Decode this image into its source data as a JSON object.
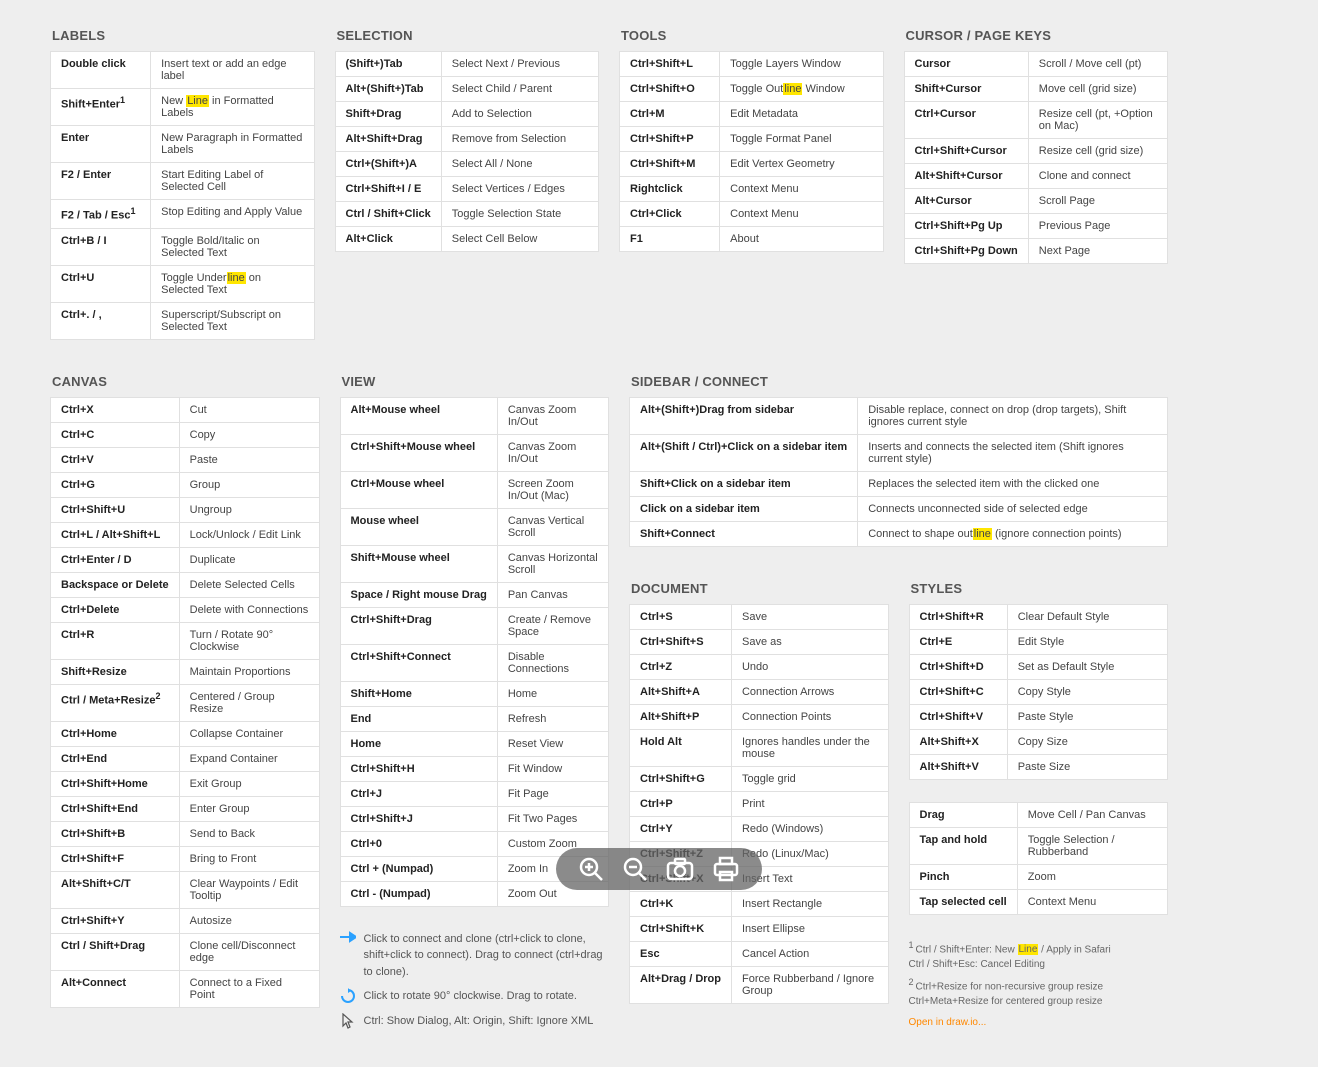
{
  "sections": {
    "labels": {
      "title": "LABELS",
      "rows": [
        {
          "k": "Double click",
          "d": "Insert text or add an edge label"
        },
        {
          "k": "Shift+Enter",
          "k_sup": "1",
          "d": "New [[Line]] in Formatted Labels"
        },
        {
          "k": "Enter",
          "d": "New Paragraph in Formatted Labels"
        },
        {
          "k": "F2 / Enter",
          "d": "Start Editing Label of Selected Cell"
        },
        {
          "k": "F2 / Tab / Esc",
          "k_sup": "1",
          "d": "Stop Editing and Apply Value"
        },
        {
          "k": "Ctrl+B / I",
          "d": "Toggle Bold/Italic on Selected Text"
        },
        {
          "k": "Ctrl+U",
          "d": "Toggle Under[[line]] on Selected Text"
        },
        {
          "k": "Ctrl+. / ,",
          "d": "Superscript/Subscript on Selected Text"
        }
      ]
    },
    "selection": {
      "title": "SELECTION",
      "rows": [
        {
          "k": "(Shift+)Tab",
          "d": "Select Next / Previous"
        },
        {
          "k": "Alt+(Shift+)Tab",
          "d": "Select Child / Parent"
        },
        {
          "k": "Shift+Drag",
          "d": "Add to Selection"
        },
        {
          "k": "Alt+Shift+Drag",
          "d": "Remove from Selection"
        },
        {
          "k": "Ctrl+(Shift+)A",
          "d": "Select All / None"
        },
        {
          "k": "Ctrl+Shift+I / E",
          "d": "Select Vertices / Edges"
        },
        {
          "k": "Ctrl / Shift+Click",
          "d": "Toggle Selection State"
        },
        {
          "k": "Alt+Click",
          "d": "Select Cell Below"
        }
      ]
    },
    "tools": {
      "title": "TOOLS",
      "rows": [
        {
          "k": "Ctrl+Shift+L",
          "d": "Toggle Layers Window"
        },
        {
          "k": "Ctrl+Shift+O",
          "d": "Toggle Out[[line]] Window"
        },
        {
          "k": "Ctrl+M",
          "d": "Edit Metadata"
        },
        {
          "k": "Ctrl+Shift+P",
          "d": "Toggle Format Panel"
        },
        {
          "k": "Ctrl+Shift+M",
          "d": "Edit Vertex Geometry"
        },
        {
          "k": "Rightclick",
          "d": "Context Menu"
        },
        {
          "k": "Ctrl+Click",
          "d": "Context Menu"
        },
        {
          "k": "F1",
          "d": "About"
        }
      ]
    },
    "cursor": {
      "title": "CURSOR / PAGE KEYS",
      "rows": [
        {
          "k": "Cursor",
          "d": "Scroll / Move cell (pt)"
        },
        {
          "k": "Shift+Cursor",
          "d": "Move cell (grid size)"
        },
        {
          "k": "Ctrl+Cursor",
          "d": "Resize cell (pt, +Option on Mac)"
        },
        {
          "k": "Ctrl+Shift+Cursor",
          "d": "Resize cell (grid size)"
        },
        {
          "k": "Alt+Shift+Cursor",
          "d": "Clone and connect"
        },
        {
          "k": "Alt+Cursor",
          "d": "Scroll Page"
        },
        {
          "k": "Ctrl+Shift+Pg Up",
          "d": "Previous Page"
        },
        {
          "k": "Ctrl+Shift+Pg Down",
          "d": "Next Page"
        }
      ]
    },
    "canvas": {
      "title": "CANVAS",
      "rows": [
        {
          "k": "Ctrl+X",
          "d": "Cut"
        },
        {
          "k": "Ctrl+C",
          "d": "Copy"
        },
        {
          "k": "Ctrl+V",
          "d": "Paste"
        },
        {
          "k": "Ctrl+G",
          "d": "Group"
        },
        {
          "k": "Ctrl+Shift+U",
          "d": "Ungroup"
        },
        {
          "k": "Ctrl+L / Alt+Shift+L",
          "d": "Lock/Unlock / Edit Link"
        },
        {
          "k": "Ctrl+Enter / D",
          "d": "Duplicate"
        },
        {
          "k": "Backspace or Delete",
          "d": "Delete Selected Cells"
        },
        {
          "k": "Ctrl+Delete",
          "d": "Delete with Connections"
        },
        {
          "k": "Ctrl+R",
          "d": "Turn / Rotate 90° Clockwise"
        },
        {
          "k": "Shift+Resize",
          "d": "Maintain Proportions"
        },
        {
          "k": "Ctrl / Meta+Resize",
          "k_sup": "2",
          "d": "Centered / Group Resize"
        },
        {
          "k": "Ctrl+Home",
          "d": "Collapse Container"
        },
        {
          "k": "Ctrl+End",
          "d": "Expand Container"
        },
        {
          "k": "Ctrl+Shift+Home",
          "d": "Exit Group"
        },
        {
          "k": "Ctrl+Shift+End",
          "d": "Enter Group"
        },
        {
          "k": "Ctrl+Shift+B",
          "d": "Send to Back"
        },
        {
          "k": "Ctrl+Shift+F",
          "d": "Bring to Front"
        },
        {
          "k": "Alt+Shift+C/T",
          "d": "Clear Waypoints / Edit Tooltip"
        },
        {
          "k": "Ctrl+Shift+Y",
          "d": "Autosize"
        },
        {
          "k": "Ctrl / Shift+Drag",
          "d": "Clone cell/Disconnect edge"
        },
        {
          "k": "Alt+Connect",
          "d": "Connect to a Fixed Point"
        }
      ]
    },
    "view": {
      "title": "VIEW",
      "rows": [
        {
          "k": "Alt+Mouse wheel",
          "d": "Canvas Zoom In/Out"
        },
        {
          "k": "Ctrl+Shift+Mouse wheel",
          "d": "Canvas Zoom In/Out"
        },
        {
          "k": "Ctrl+Mouse wheel",
          "d": "Screen Zoom In/Out (Mac)"
        },
        {
          "k": "Mouse wheel",
          "d": "Canvas Vertical Scroll"
        },
        {
          "k": "Shift+Mouse wheel",
          "d": "Canvas Horizontal Scroll"
        },
        {
          "k": "Space / Right mouse Drag",
          "d": "Pan Canvas"
        },
        {
          "k": "Ctrl+Shift+Drag",
          "d": "Create / Remove Space"
        },
        {
          "k": "Ctrl+Shift+Connect",
          "d": "Disable Connections"
        },
        {
          "k": "Shift+Home",
          "d": "Home"
        },
        {
          "k": "End",
          "d": "Refresh"
        },
        {
          "k": "Home",
          "d": "Reset View"
        },
        {
          "k": "Ctrl+Shift+H",
          "d": "Fit Window"
        },
        {
          "k": "Ctrl+J",
          "d": "Fit Page"
        },
        {
          "k": "Ctrl+Shift+J",
          "d": "Fit Two Pages"
        },
        {
          "k": "Ctrl+0",
          "d": "Custom Zoom"
        },
        {
          "k": "Ctrl + (Numpad)",
          "d": "Zoom In"
        },
        {
          "k": "Ctrl - (Numpad)",
          "d": "Zoom Out"
        }
      ]
    },
    "sidebar": {
      "title": "SIDEBAR / CONNECT",
      "rows": [
        {
          "k": "Alt+(Shift+)Drag from sidebar",
          "d": "Disable replace, connect on drop (drop targets), Shift ignores current style"
        },
        {
          "k": "Alt+(Shift / Ctrl)+Click on a sidebar item",
          "d": "Inserts and connects the selected item (Shift ignores current style)"
        },
        {
          "k": "Shift+Click on a sidebar item",
          "d": "Replaces the selected item with the clicked one"
        },
        {
          "k": "Click on a sidebar item",
          "d": "Connects unconnected side of selected edge"
        },
        {
          "k": "Shift+Connect",
          "d": "Connect to shape out[[line]] (ignore connection points)"
        }
      ]
    },
    "document": {
      "title": "DOCUMENT",
      "rows": [
        {
          "k": "Ctrl+S",
          "d": "Save"
        },
        {
          "k": "Ctrl+Shift+S",
          "d": "Save as"
        },
        {
          "k": "Ctrl+Z",
          "d": "Undo"
        },
        {
          "k": "Alt+Shift+A",
          "d": "Connection Arrows"
        },
        {
          "k": "Alt+Shift+P",
          "d": "Connection Points"
        },
        {
          "k": "Hold Alt",
          "d": "Ignores handles under the mouse"
        },
        {
          "k": "Ctrl+Shift+G",
          "d": "Toggle grid"
        },
        {
          "k": "Ctrl+P",
          "d": "Print"
        },
        {
          "k": "Ctrl+Y",
          "d": "Redo (Windows)"
        },
        {
          "k": "Ctrl+Shift+Z",
          "d": "Redo (Linux/Mac)"
        },
        {
          "k": "Ctrl+Shift+X",
          "d": "Insert Text"
        },
        {
          "k": "Ctrl+K",
          "d": "Insert Rectangle"
        },
        {
          "k": "Ctrl+Shift+K",
          "d": "Insert Ellipse"
        },
        {
          "k": "Esc",
          "d": "Cancel Action"
        },
        {
          "k": "Alt+Drag / Drop",
          "d": "Force Rubberband / Ignore Group"
        }
      ]
    },
    "styles": {
      "title": "STYLES",
      "rows": [
        {
          "k": "Ctrl+Shift+R",
          "d": "Clear Default Style"
        },
        {
          "k": "Ctrl+E",
          "d": "Edit Style"
        },
        {
          "k": "Ctrl+Shift+D",
          "d": "Set as Default Style"
        },
        {
          "k": "Ctrl+Shift+C",
          "d": "Copy Style"
        },
        {
          "k": "Ctrl+Shift+V",
          "d": "Paste Style"
        },
        {
          "k": "Alt+Shift+X",
          "d": "Copy Size"
        },
        {
          "k": "Alt+Shift+V",
          "d": "Paste Size"
        }
      ]
    },
    "touch": {
      "rows": [
        {
          "k": "Drag",
          "d": "Move Cell / Pan Canvas"
        },
        {
          "k": "Tap and hold",
          "d": "Toggle Selection / Rubberband"
        },
        {
          "k": "Pinch",
          "d": "Zoom"
        },
        {
          "k": "Tap selected cell",
          "d": "Context Menu"
        }
      ]
    }
  },
  "tips": {
    "arrow": "Click to connect and clone (ctrl+click to clone, shift+click to connect). Drag to connect (ctrl+drag to clone).",
    "rotate": "Click to rotate 90° clockwise. Drag to rotate.",
    "cursor": "Ctrl: Show Dialog, Alt: Origin, Shift: Ignore XML"
  },
  "footnotes": {
    "f1a": "Ctrl / Shift+Enter: New ",
    "f1b": " / Apply in Safari",
    "f1c": "Ctrl / Shift+Esc: Cancel Editing",
    "f2a": "Ctrl+Resize for non-recursive group resize",
    "f2b": "Ctrl+Meta+Resize for centered group resize",
    "link": "Open in draw.io..."
  },
  "highlight_word": "Line"
}
